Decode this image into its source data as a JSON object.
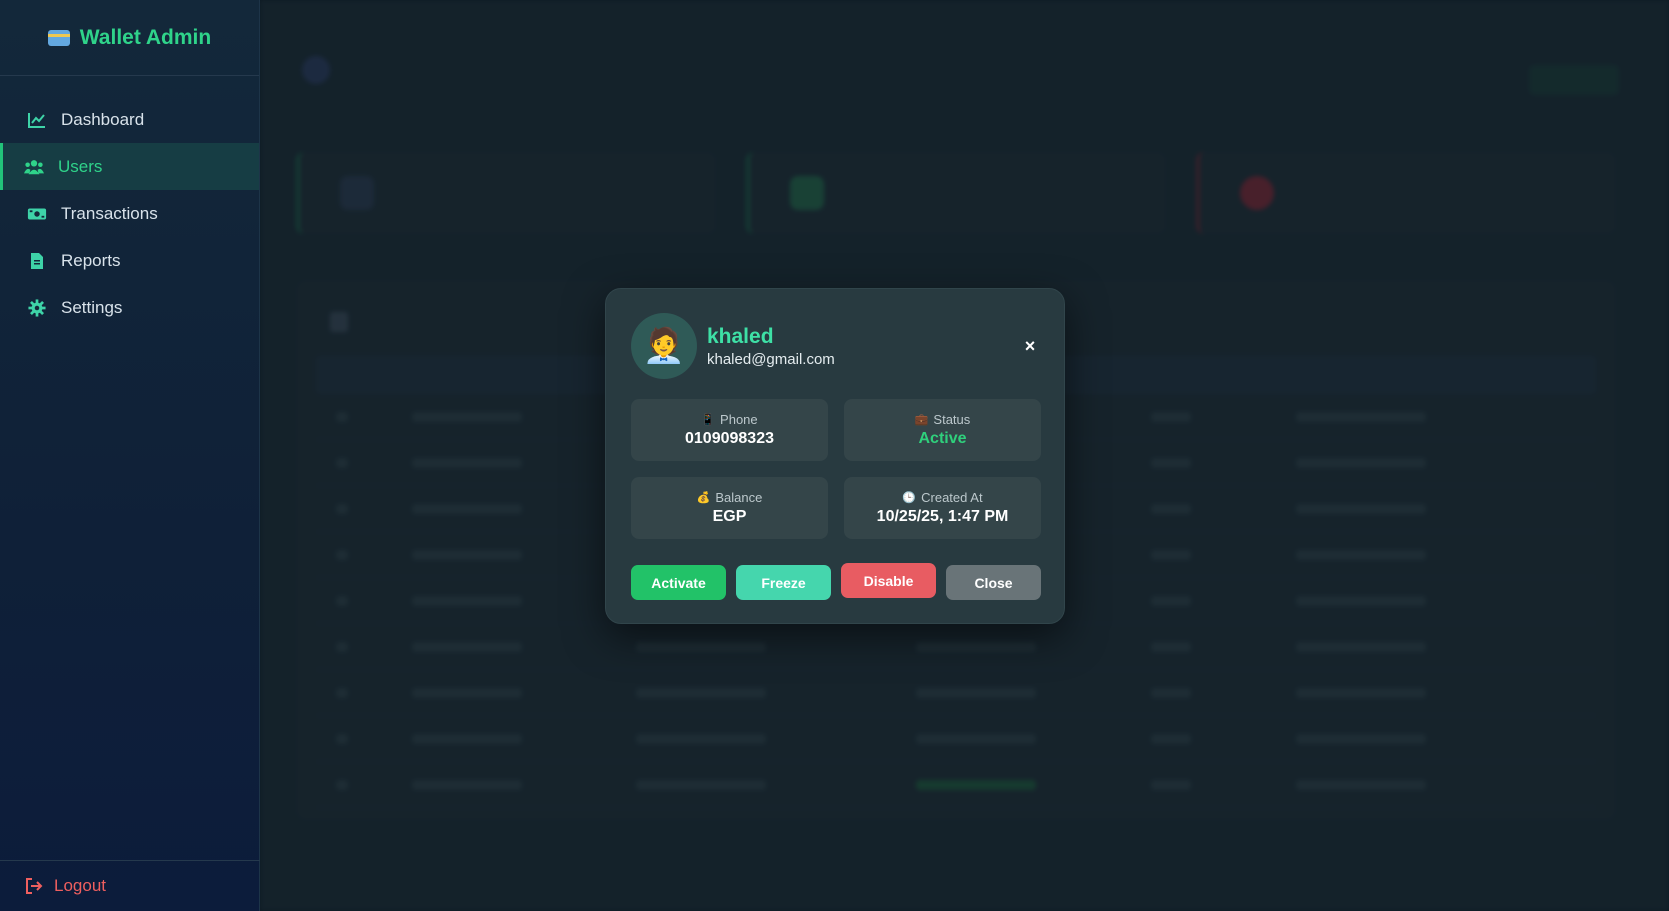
{
  "sidebar": {
    "brand": "Wallet Admin",
    "brand_icon": "credit-card-icon",
    "items": [
      {
        "label": "Dashboard",
        "icon": "line-chart-icon",
        "active": false
      },
      {
        "label": "Users",
        "icon": "users-icon",
        "active": true
      },
      {
        "label": "Transactions",
        "icon": "money-bill-icon",
        "active": false
      },
      {
        "label": "Reports",
        "icon": "file-icon",
        "active": false
      },
      {
        "label": "Settings",
        "icon": "gear-icon",
        "active": false
      }
    ],
    "logout": "Logout"
  },
  "modal": {
    "name": "khaled",
    "email": "khaled@gmail.com",
    "avatar": "person-avatar-icon",
    "close_symbol": "×",
    "phone_label": "Phone",
    "phone": "0109098323",
    "status_label": "Status",
    "status": "Active",
    "balance_label": "Balance",
    "balance": "EGP",
    "created_label": "Created At",
    "created": "10/25/25, 1:47 PM",
    "buttons": {
      "activate": "Activate",
      "freeze": "Freeze",
      "disable": "Disable",
      "close": "Close"
    }
  },
  "colors": {
    "accent": "#2fd38a",
    "activate": "#22c268",
    "freeze": "#45d6ad",
    "disable": "#e85c62",
    "close": "#697478",
    "logout": "#ef5f5f"
  }
}
